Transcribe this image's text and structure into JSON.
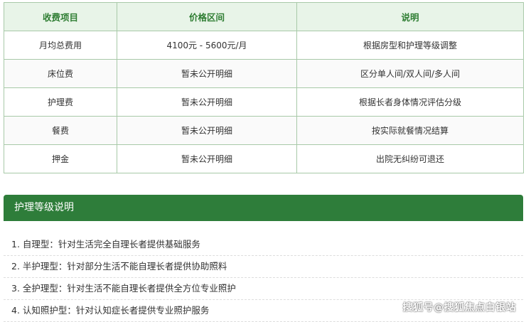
{
  "fee_table": {
    "headers": [
      "收费项目",
      "价格区间",
      "说明"
    ],
    "rows": [
      [
        "月均总费用",
        "4100元 - 5600元/月",
        "根据房型和护理等级调整"
      ],
      [
        "床位费",
        "暂未公开明细",
        "区分单人间/双人间/多人间"
      ],
      [
        "护理费",
        "暂未公开明细",
        "根据长者身体情况评估分级"
      ],
      [
        "餐费",
        "暂未公开明细",
        "按实际就餐情况结算"
      ],
      [
        "押金",
        "暂未公开明细",
        "出院无纠纷可退还"
      ]
    ]
  },
  "care_levels": {
    "title": "护理等级说明",
    "items": [
      "1. 自理型：针对生活完全自理长者提供基础服务",
      "2. 半护理型：针对部分生活不能自理长者提供协助照料",
      "3. 全护理型：针对生活不能自理长者提供全方位专业照护",
      "4. 认知照护型：针对认知症长者提供专业照护服务"
    ]
  },
  "watermark": "搜狐号@搜狐焦点白银站",
  "colors": {
    "accent": "#2e7d3a",
    "header_bg": "#e8f4e8",
    "border": "#a8c9a8"
  }
}
